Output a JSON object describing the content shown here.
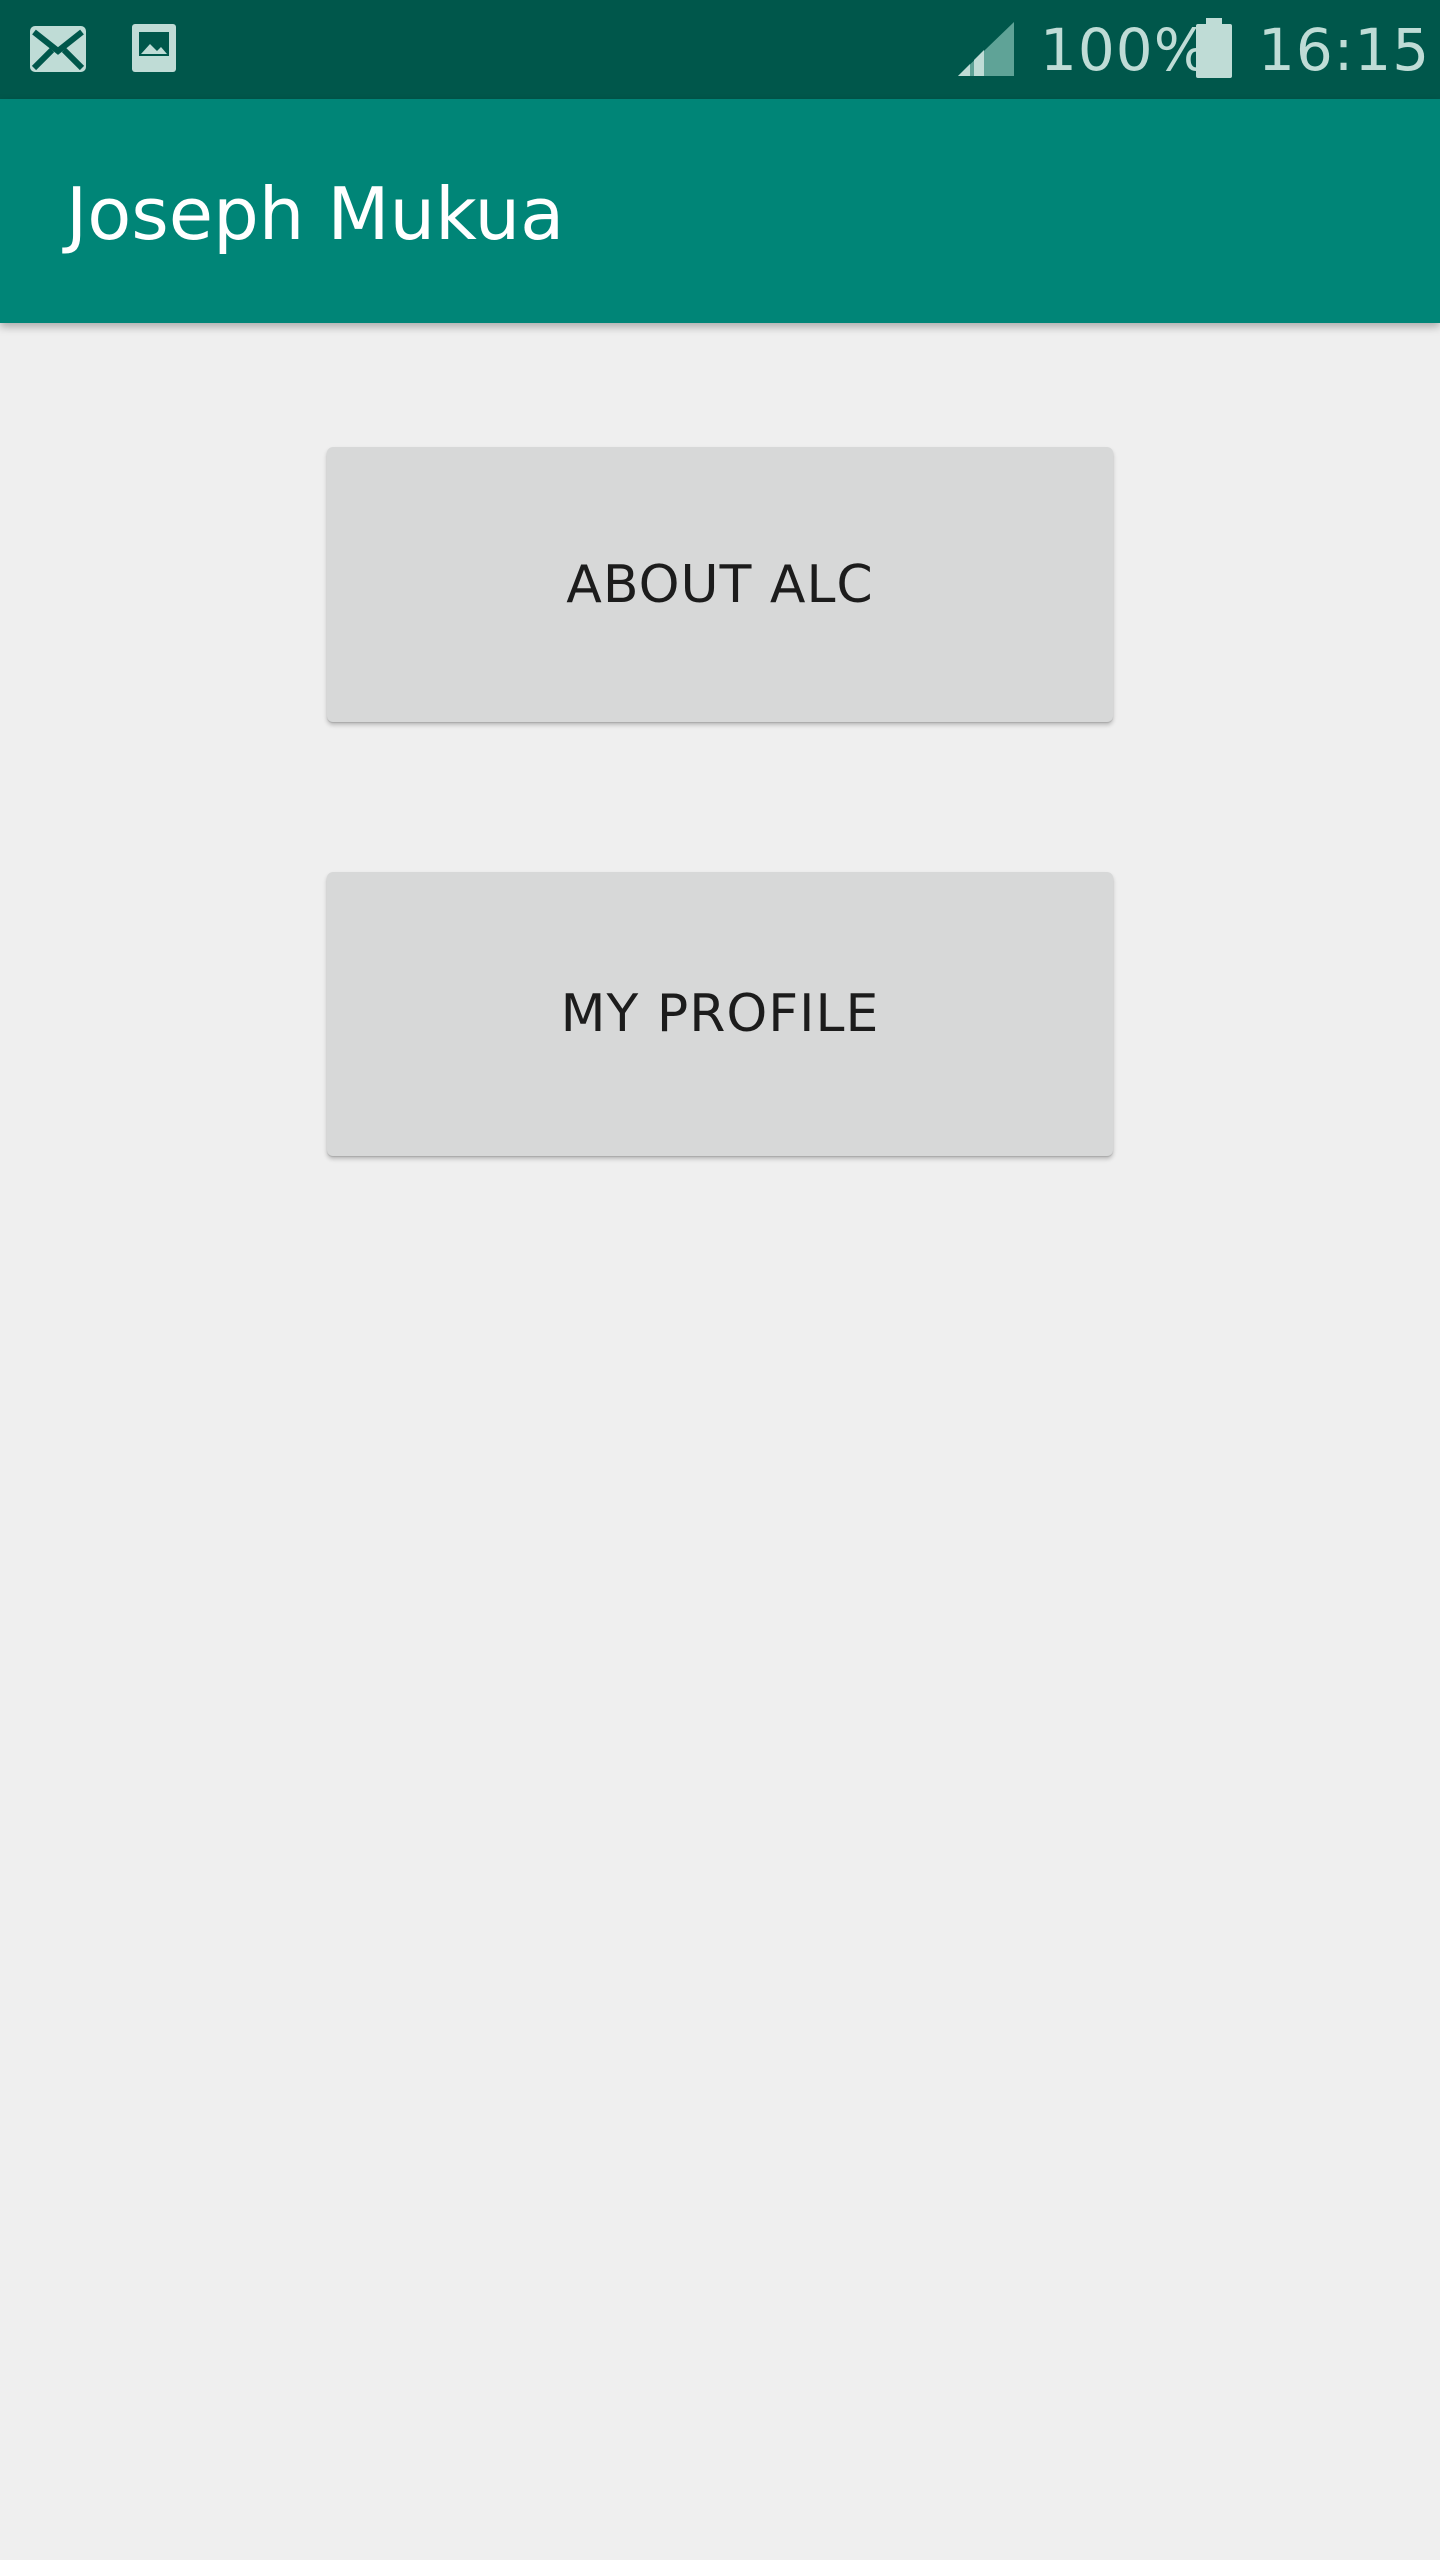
{
  "status_bar": {
    "icons": [
      "mail-icon",
      "image-icon",
      "signal-icon",
      "battery-icon"
    ],
    "battery_label": "100%",
    "time": "16:15"
  },
  "app_bar": {
    "title": "Joseph Mukua"
  },
  "main": {
    "about_label": "ABOUT ALC",
    "profile_label": "MY PROFILE"
  },
  "colors": {
    "status_bar": "#00574b",
    "app_bar": "#008577",
    "background": "#efefef",
    "button": "#d7d8d8"
  }
}
